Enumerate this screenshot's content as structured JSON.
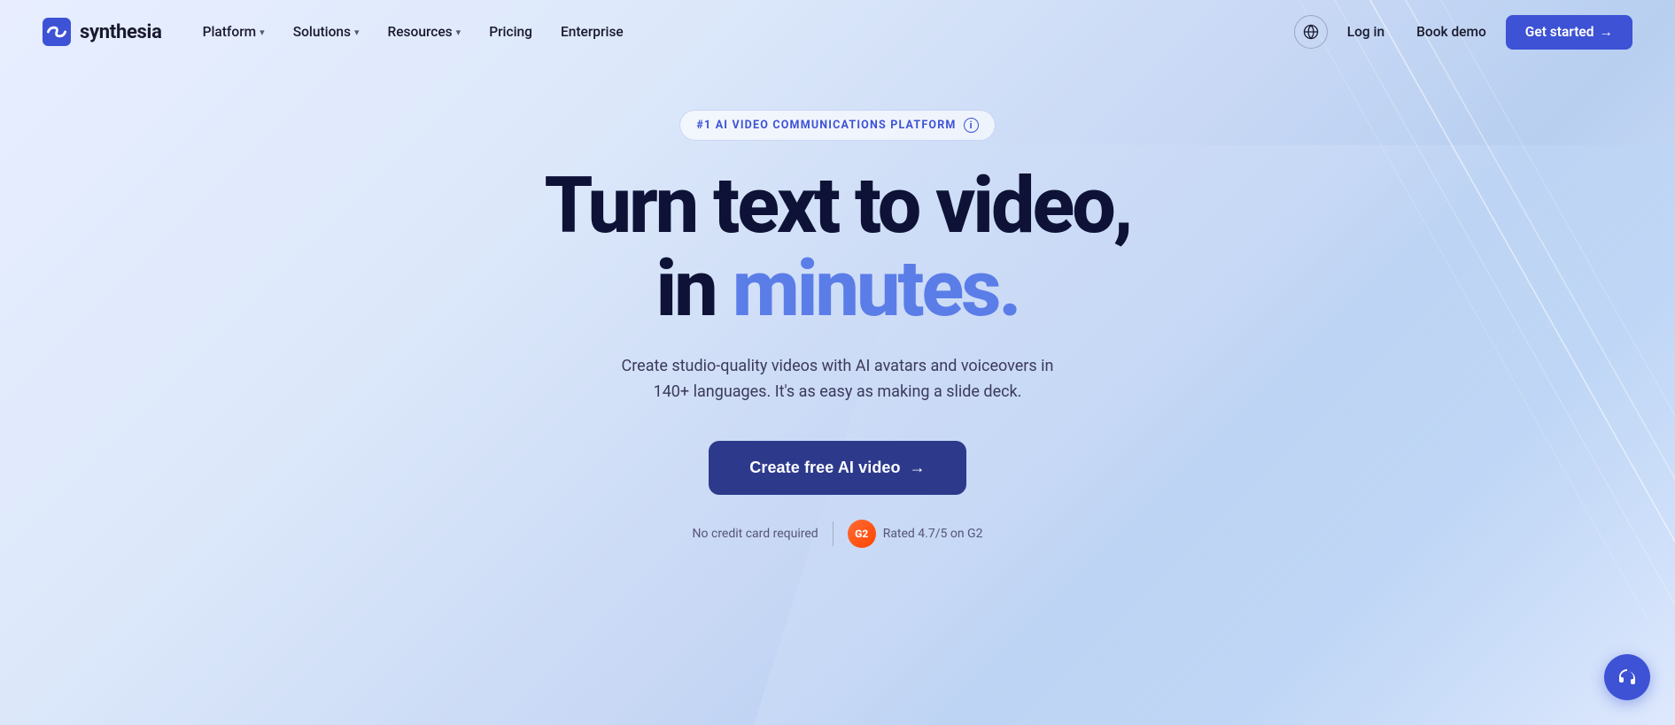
{
  "logo": {
    "text": "synthesia"
  },
  "nav": {
    "items": [
      {
        "label": "Platform",
        "has_dropdown": true
      },
      {
        "label": "Solutions",
        "has_dropdown": true
      },
      {
        "label": "Resources",
        "has_dropdown": true
      },
      {
        "label": "Pricing",
        "has_dropdown": false
      },
      {
        "label": "Enterprise",
        "has_dropdown": false
      }
    ],
    "globe_label": "Language selector",
    "login_label": "Log in",
    "book_demo_label": "Book demo",
    "get_started_label": "Get started",
    "get_started_arrow": "→"
  },
  "hero": {
    "badge_text": "#1 AI VIDEO COMMUNICATIONS PLATFORM",
    "badge_info": "i",
    "title_line1": "Turn text to video,",
    "title_line2_plain": "in ",
    "title_line2_highlight": "minutes.",
    "subtitle": "Create studio-quality videos with AI avatars and voiceovers in 140+ languages. It's as easy as making a slide deck.",
    "cta_label": "Create free AI video",
    "cta_arrow": "→",
    "footer_no_cc": "No credit card required",
    "footer_rating": "Rated 4.7/5 on G2",
    "g2_label": "G2"
  },
  "support": {
    "label": "Support chat"
  }
}
